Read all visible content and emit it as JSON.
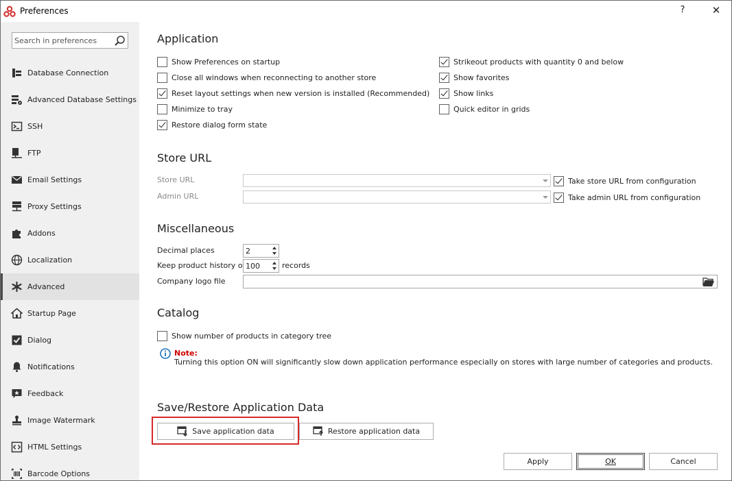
{
  "window": {
    "title": "Preferences",
    "help_label": "?",
    "close_label": "✕"
  },
  "sidebar": {
    "search_placeholder": "Search in preferences",
    "items": [
      {
        "label": "Database Connection",
        "icon": "database-icon"
      },
      {
        "label": "Advanced Database Settings",
        "icon": "database-settings-icon"
      },
      {
        "label": "SSH",
        "icon": "terminal-icon"
      },
      {
        "label": "FTP",
        "icon": "ftp-icon"
      },
      {
        "label": "Email Settings",
        "icon": "envelope-icon"
      },
      {
        "label": "Proxy Settings",
        "icon": "server-icon"
      },
      {
        "label": "Addons",
        "icon": "puzzle-icon"
      },
      {
        "label": "Localization",
        "icon": "globe-icon"
      },
      {
        "label": "Advanced",
        "icon": "asterisk-icon",
        "active": true
      },
      {
        "label": "Startup Page",
        "icon": "home-icon"
      },
      {
        "label": "Dialog",
        "icon": "check-square-icon"
      },
      {
        "label": "Notifications",
        "icon": "bell-icon"
      },
      {
        "label": "Feedback",
        "icon": "feedback-icon"
      },
      {
        "label": "Image Watermark",
        "icon": "stamp-icon"
      },
      {
        "label": "HTML Settings",
        "icon": "code-icon"
      },
      {
        "label": "Barcode Options",
        "icon": "barcode-icon"
      }
    ]
  },
  "application": {
    "title": "Application",
    "left_options": [
      {
        "label": "Show Preferences on startup",
        "checked": false
      },
      {
        "label": "Close all windows when reconnecting to another store",
        "checked": false
      },
      {
        "label": "Reset layout settings when new version is installed (Recommended)",
        "checked": true
      },
      {
        "label": "Minimize to tray",
        "checked": false
      },
      {
        "label": "Restore dialog form state",
        "checked": true
      }
    ],
    "right_options": [
      {
        "label": "Strikeout products with quantity 0 and below",
        "checked": true
      },
      {
        "label": "Show favorites",
        "checked": true
      },
      {
        "label": "Show links",
        "checked": true
      },
      {
        "label": "Quick editor in grids",
        "checked": false
      }
    ]
  },
  "store_url": {
    "title": "Store URL",
    "store_label": "Store URL",
    "admin_label": "Admin URL",
    "store_value": "",
    "admin_value": "",
    "take_store_label": "Take store URL from configuration",
    "take_store_checked": true,
    "take_admin_label": "Take admin URL from configuration",
    "take_admin_checked": true
  },
  "misc": {
    "title": "Miscellaneous",
    "decimal_label": "Decimal places",
    "decimal_value": "2",
    "history_label": "Keep product history of",
    "history_value": "100",
    "history_suffix": "records",
    "logo_label": "Company logo file",
    "logo_value": ""
  },
  "catalog": {
    "title": "Catalog",
    "option_label": "Show number of products in category tree",
    "option_checked": false,
    "note_title": "Note:",
    "note_text": "Turning this option ON will significantly slow down application performance especially on stores with large number of categories and products."
  },
  "save_restore": {
    "title": "Save/Restore Application Data",
    "save_label": "Save application data",
    "restore_label": "Restore application data"
  },
  "footer": {
    "apply_label": "Apply",
    "ok_label": "OK",
    "cancel_label": "Cancel"
  },
  "colors": {
    "highlight": "#d62828",
    "note_red": "#d10000",
    "info_blue": "#1e73be",
    "app_icon_red": "#d32f2f"
  }
}
